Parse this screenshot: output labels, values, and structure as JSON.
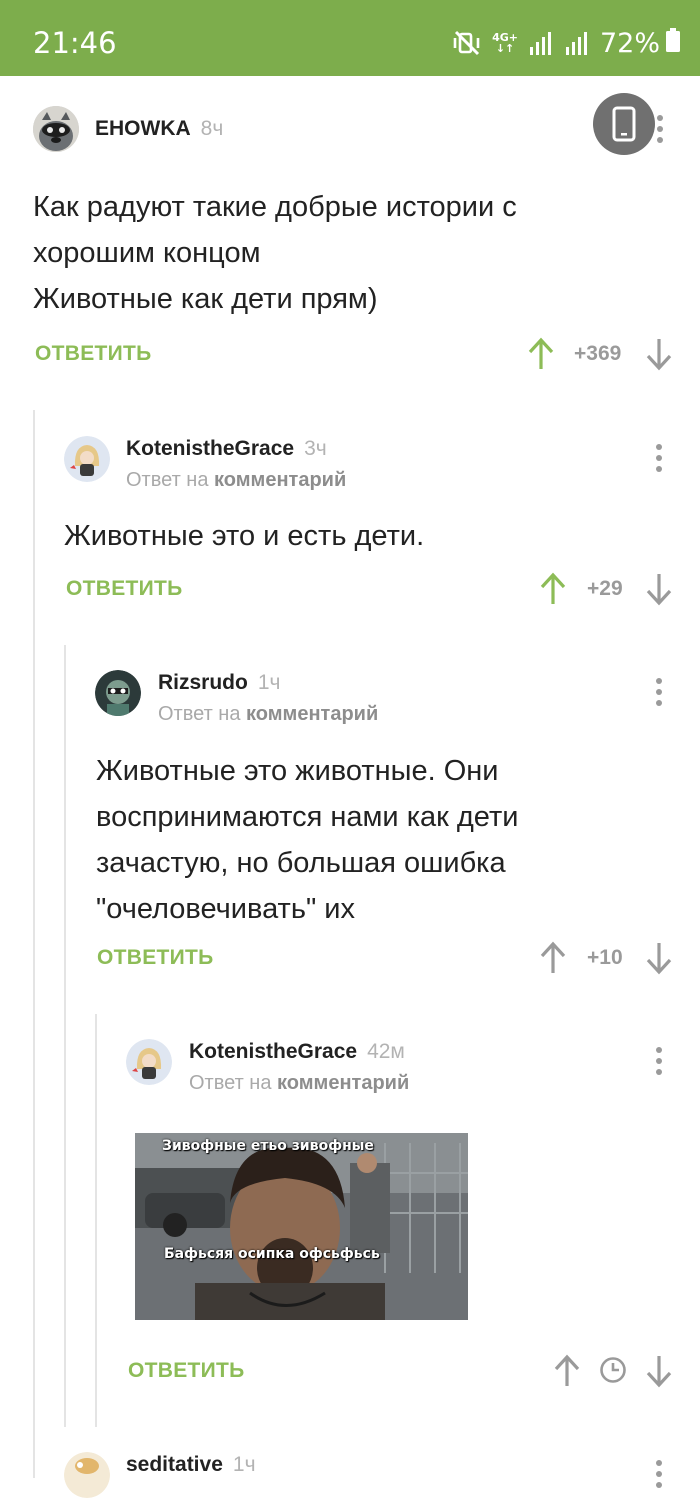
{
  "status_bar": {
    "time": "21:46",
    "network": "4G+",
    "battery": "72%",
    "icons": [
      "mute-vibrate-icon",
      "signal-icon",
      "signal-icon",
      "battery-icon"
    ]
  },
  "colors": {
    "accent": "#8dbc57",
    "status_bar": "#7dad4c",
    "muted": "#9a9a9a"
  },
  "comments": [
    {
      "author": "EHOWKA",
      "time": "8ч",
      "text": "Как радуют такие добрые истории с\nхорошим концом\nЖивотные как дети прям)",
      "reply_label": "ОТВЕТИТЬ",
      "score": "+369",
      "voted": "up"
    },
    {
      "author": "KotenistheGrace",
      "time": "3ч",
      "reply_prefix": "Ответ на",
      "reply_link": "комментарий",
      "text": "Животные это и есть дети.",
      "reply_label": "ОТВЕТИТЬ",
      "score": "+29",
      "voted": "up"
    },
    {
      "author": "Rizsrudo",
      "time": "1ч",
      "reply_prefix": "Ответ на",
      "reply_link": "комментарий",
      "text": "Животные это животные. Они\nвоспринимаются нами как дети\nзачастую, но большая ошибка\n\"очеловечивать\" их",
      "reply_label": "ОТВЕТИТЬ",
      "score": "+10",
      "voted": "none"
    },
    {
      "author": "KotenistheGrace",
      "time": "42м",
      "reply_prefix": "Ответ на",
      "reply_link": "комментарий",
      "image_caption_top": "Зивофные етьо зивофные",
      "image_caption_bottom": "Бафьсяя осипка офсьфьсь",
      "reply_label": "ОТВЕТИТЬ",
      "score_state": "pending"
    },
    {
      "author": "seditative",
      "time": "1ч"
    }
  ]
}
